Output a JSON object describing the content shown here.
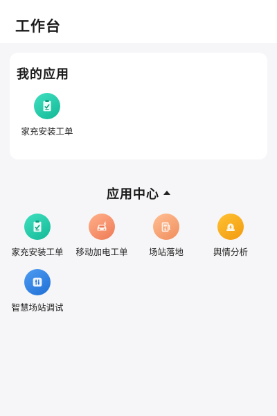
{
  "header": {
    "title": "工作台"
  },
  "my_apps": {
    "title": "我的应用",
    "items": [
      {
        "label": "家充安装工单",
        "icon": "clipboard-icon",
        "color": "#1fc7a8"
      }
    ]
  },
  "app_center": {
    "title": "应用中心",
    "items": [
      {
        "label": "家充安装工单",
        "icon": "clipboard-icon",
        "color": "#1fc7a8"
      },
      {
        "label": "移动加电工单",
        "icon": "car-icon",
        "color": "#f28a64"
      },
      {
        "label": "场站落地",
        "icon": "charging-station-icon",
        "color": "#f39a6a"
      },
      {
        "label": "舆情分析",
        "icon": "warning-light-icon",
        "color": "#f7a51a"
      },
      {
        "label": "智慧场站调试",
        "icon": "sliders-icon",
        "color": "#2a7de1"
      }
    ]
  }
}
